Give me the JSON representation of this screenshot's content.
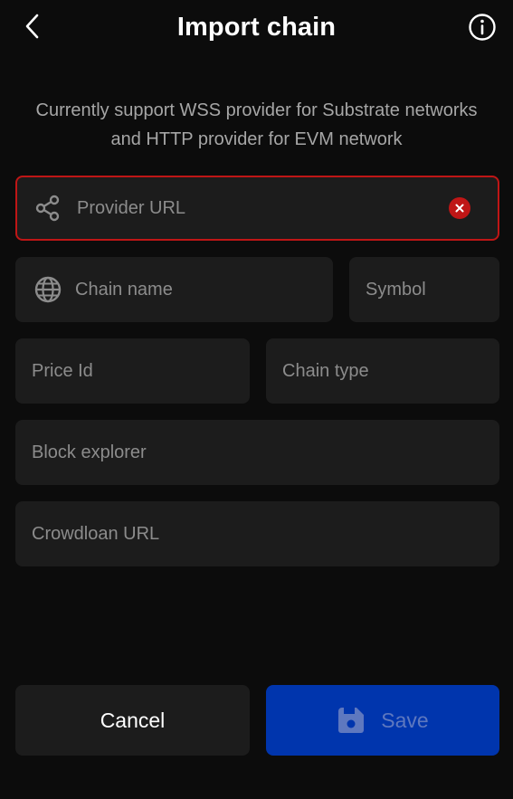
{
  "header": {
    "title": "Import chain",
    "back_icon": "chevron-left-icon",
    "info_icon": "info-icon"
  },
  "description": "Currently support WSS provider for Substrate networks and HTTP provider for EVM network",
  "form": {
    "provider_url": {
      "placeholder": "Provider URL",
      "value": "",
      "icon": "share-icon",
      "error": true,
      "clear_icon": "clear-x-icon"
    },
    "chain_name": {
      "placeholder": "Chain name",
      "value": "",
      "icon": "globe-icon"
    },
    "symbol": {
      "placeholder": "Symbol",
      "value": ""
    },
    "price_id": {
      "placeholder": "Price Id",
      "value": ""
    },
    "chain_type": {
      "placeholder": "Chain type",
      "value": ""
    },
    "block_explorer": {
      "placeholder": "Block explorer",
      "value": ""
    },
    "crowdloan_url": {
      "placeholder": "Crowdloan URL",
      "value": ""
    }
  },
  "actions": {
    "cancel_label": "Cancel",
    "save_label": "Save",
    "save_icon": "floppy-disk-icon",
    "save_disabled": true
  },
  "colors": {
    "background": "#0c0c0c",
    "field": "#1c1c1c",
    "error": "#bf1616",
    "primary": "#0035ad",
    "muted_text": "#8c8c8c"
  }
}
